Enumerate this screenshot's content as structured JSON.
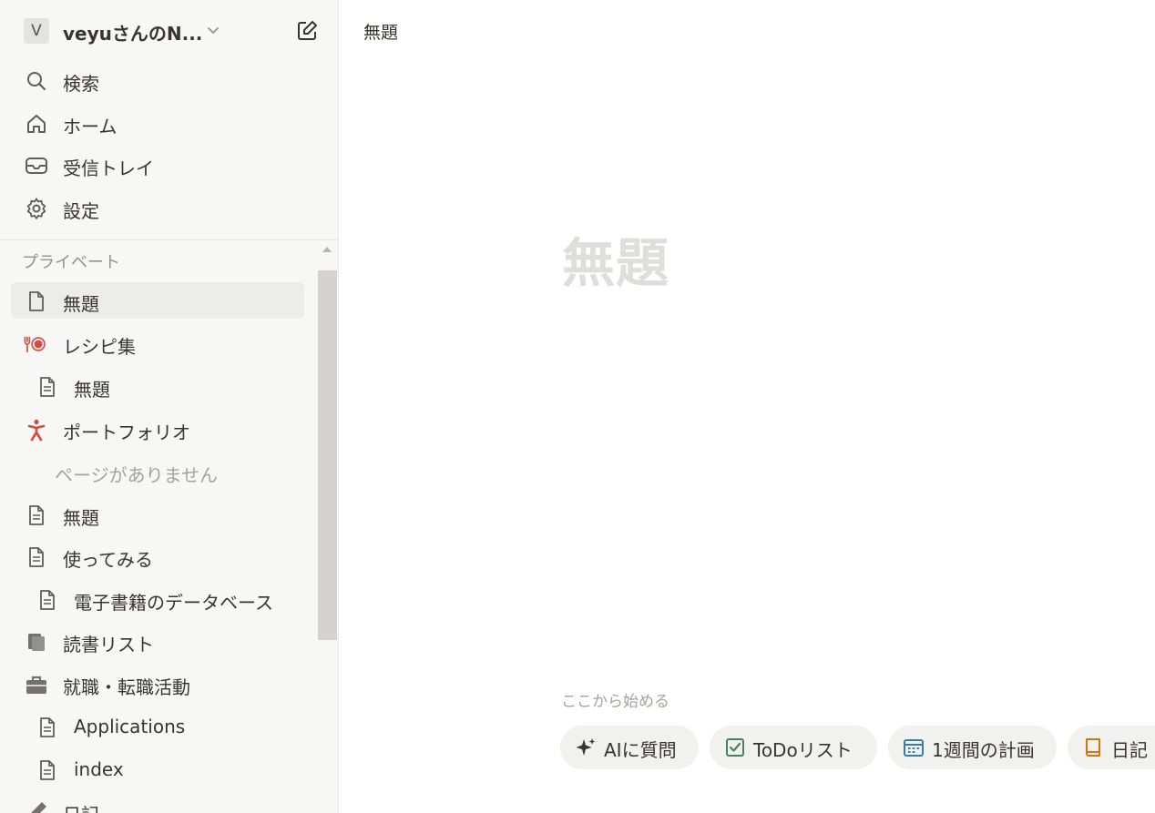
{
  "workspace": {
    "avatar": "V",
    "name": "veyuさんのN..."
  },
  "nav": {
    "search": "検索",
    "home": "ホーム",
    "inbox": "受信トレイ",
    "settings": "設定"
  },
  "private": {
    "section": "プライベート",
    "items": [
      {
        "label": "無題",
        "icon": "page-icon",
        "selected": true
      },
      {
        "label": "レシピ集",
        "icon": "recipe-icon"
      },
      {
        "label": "無題",
        "icon": "page-text-icon"
      },
      {
        "label": "ポートフォリオ",
        "icon": "person-icon"
      },
      {
        "label": "ページがありません",
        "icon": ""
      },
      {
        "label": "無題",
        "icon": "page-text-icon"
      },
      {
        "label": "使ってみる",
        "icon": "page-text-icon"
      },
      {
        "label": "電子書籍のデータベース",
        "icon": "page-text-icon"
      },
      {
        "label": "読書リスト",
        "icon": "books-icon"
      },
      {
        "label": "就職・転職活動",
        "icon": "briefcase-icon"
      },
      {
        "label": "Applications",
        "icon": "page-text-icon"
      },
      {
        "label": "index",
        "icon": "page-text-icon"
      },
      {
        "label": "日記",
        "icon": "pencil-icon"
      }
    ]
  },
  "page": {
    "breadcrumb": "無題",
    "title_placeholder": "無題",
    "start_label": "ここから始める"
  },
  "chips": [
    {
      "label": "AIに質問",
      "icon": "sparkle-icon"
    },
    {
      "label": "ToDoリスト",
      "icon": "checkbox-icon"
    },
    {
      "label": "1週間の計画",
      "icon": "calendar-icon"
    },
    {
      "label": "日記",
      "icon": "journal-icon"
    }
  ],
  "colors": {
    "sidebar_bg": "#f7f7f5",
    "accent_red": "#d44c47",
    "selected_bg": "#ececea"
  }
}
